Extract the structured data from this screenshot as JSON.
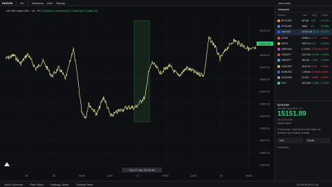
{
  "topbar": {
    "symbol": "NAS100",
    "interval": "1m",
    "indicators": "Indicators",
    "alert": "Alert",
    "replay": "Replay",
    "layout_name": "arius best"
  },
  "legend": {
    "title": "US 100 Cash CFD · 15 · FX",
    "ohlc": "O14953.53 H14953.03 L14955.83 C14952.03"
  },
  "chart": {
    "price_labels": [
      "15100.00",
      "15075.00",
      "15050.00",
      "15025.00",
      "15000.00",
      "14975.00",
      "14950.00",
      "14925.00",
      "14900.00",
      "14875.00",
      "14850.00",
      "14825.00"
    ],
    "time_labels": [
      "25",
      "26",
      "06:00",
      "12:00",
      "27",
      "06:00",
      "12:00",
      "28",
      "06:00"
    ],
    "highlight_time": "Tue 27 Jun '23  10:30",
    "last_price_tag": "15151.89"
  },
  "watchlist": {
    "title": "Watchlist",
    "columns": [
      "Symbol",
      "Last",
      "Chg",
      "Chg%"
    ],
    "rows": [
      {
        "symbol": "BTCUSD",
        "last": "30746",
        "chg": "+51",
        "pct": "+0.17%",
        "color": "#f7931a",
        "dir": "pos"
      },
      {
        "symbol": "ETHUSD",
        "last": "1884",
        "chg": "+5",
        "pct": "+0.28%",
        "color": "#627eea",
        "dir": "pos"
      },
      {
        "symbol": "NAS100",
        "last": "15151.89",
        "chg": "+16.12",
        "pct": "+0.11%",
        "color": "#2962ff",
        "dir": "pos"
      },
      {
        "symbol": "US30",
        "last": "33980.1",
        "chg": "-21.3",
        "pct": "-0.06%",
        "color": "#e04b4b",
        "dir": "neg"
      },
      {
        "symbol": "DE40",
        "last": "15972.8",
        "chg": "+6.1",
        "pct": "+0.04%",
        "color": "#e0b84b",
        "dir": "pos"
      },
      {
        "symbol": "GBPUSD",
        "last": "1.27051",
        "chg": "-0.00130",
        "pct": "-0.10%",
        "color": "#c44bd6",
        "dir": "neg"
      },
      {
        "symbol": "USDJPY",
        "last": "144.310",
        "chg": "+0.235",
        "pct": "+0.16%",
        "color": "#d64b4b",
        "dir": "pos"
      },
      {
        "symbol": "GBPJPY",
        "last": "183.35",
        "chg": "+0.05",
        "pct": "+0.03%",
        "color": "#4bb7d6",
        "dir": "pos"
      },
      {
        "symbol": "XAUUSD",
        "last": "1911.54",
        "chg": "-3.39",
        "pct": "-0.18%",
        "color": "#d6b84b",
        "dir": "neg"
      },
      {
        "symbol": "EURUSD",
        "last": "1.09094",
        "chg": "-0.00086",
        "pct": "-0.08%",
        "color": "#4b6bd6",
        "dir": "neg"
      },
      {
        "symbol": "XAGUSD",
        "last": "22.827",
        "chg": "-0.056",
        "pct": "-0.25%",
        "color": "#9aa0a6",
        "dir": "neg"
      },
      {
        "symbol": "DXY",
        "last": "102.650",
        "chg": "+0.098",
        "pct": "+0.10%",
        "color": "#4bd69a",
        "dir": "pos"
      }
    ]
  },
  "detail": {
    "symbol": "NAS100",
    "name": "US 100 Cash CFD · FX",
    "price": "15151.89",
    "change": "16.12 (0.11%)",
    "status": "Market Open",
    "news": "8 hours ago · Wall Street ends higher as investors eye inflation reading",
    "btn_left": "Size",
    "btn_right": "Minute",
    "tech": "Technicals"
  },
  "bottombar": {
    "items": [
      "Stock Screener",
      "Pine Editor",
      "Strategy Tester",
      "Trading Panel"
    ],
    "clock": "01:04:19 (UTC-4)"
  }
}
